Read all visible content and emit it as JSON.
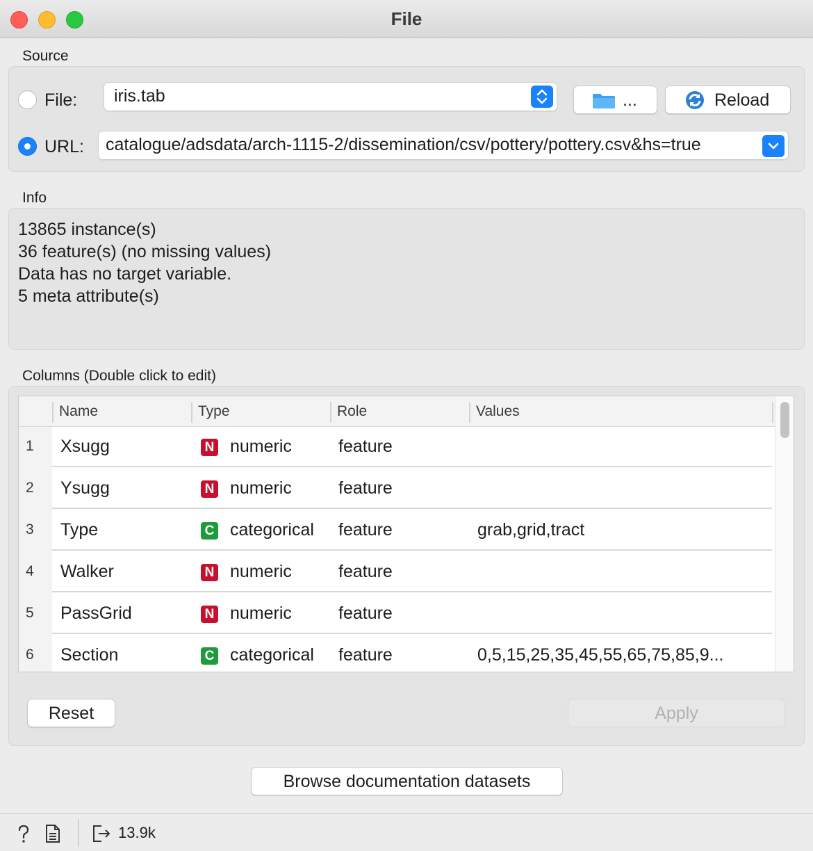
{
  "window": {
    "title": "File"
  },
  "source": {
    "label": "Source",
    "file_label": "File:",
    "file_value": "iris.tab",
    "url_label": "URL:",
    "url_value": "catalogue/adsdata/arch-1115-2/dissemination/csv/pottery/pottery.csv&hs=true",
    "browse_label": "...",
    "reload_label": "Reload",
    "selected": "URL"
  },
  "info": {
    "label": "Info",
    "lines": [
      "13865 instance(s)",
      "36 feature(s) (no missing values)",
      "Data has no target variable.",
      "5 meta attribute(s)"
    ]
  },
  "columns": {
    "label": "Columns (Double click to edit)",
    "headers": [
      "Name",
      "Type",
      "Role",
      "Values"
    ],
    "rows": [
      {
        "num": "1",
        "name": "Xsugg",
        "type_badge": "N",
        "type": "numeric",
        "role": "feature",
        "values": ""
      },
      {
        "num": "2",
        "name": "Ysugg",
        "type_badge": "N",
        "type": "numeric",
        "role": "feature",
        "values": ""
      },
      {
        "num": "3",
        "name": "Type",
        "type_badge": "C",
        "type": "categorical",
        "role": "feature",
        "values": "grab,grid,tract"
      },
      {
        "num": "4",
        "name": "Walker",
        "type_badge": "N",
        "type": "numeric",
        "role": "feature",
        "values": ""
      },
      {
        "num": "5",
        "name": "PassGrid",
        "type_badge": "N",
        "type": "numeric",
        "role": "feature",
        "values": ""
      },
      {
        "num": "6",
        "name": "Section",
        "type_badge": "C",
        "type": "categorical",
        "role": "feature",
        "values": "0,5,15,25,35,45,55,65,75,85,9..."
      }
    ],
    "reset_label": "Reset",
    "apply_label": "Apply"
  },
  "browse_docs_label": "Browse documentation datasets",
  "status": {
    "output_count": "13.9k"
  },
  "colors": {
    "numeric_badge": "#c8102e",
    "categorical_badge": "#1e9b3a",
    "accent": "#1a82fb"
  }
}
